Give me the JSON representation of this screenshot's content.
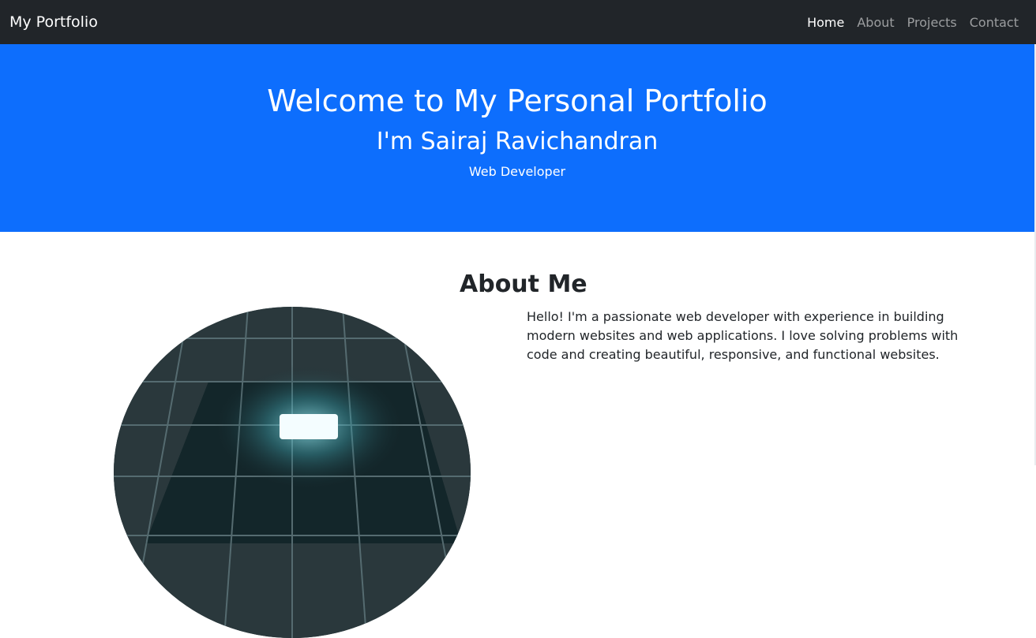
{
  "navbar": {
    "brand": "My Portfolio",
    "links": [
      {
        "label": "Home",
        "active": true
      },
      {
        "label": "About",
        "active": false
      },
      {
        "label": "Projects",
        "active": false
      },
      {
        "label": "Contact",
        "active": false
      }
    ]
  },
  "hero": {
    "title": "Welcome to My Personal Portfolio",
    "name": "I'm Sairaj Ravichandran",
    "role": "Web Developer"
  },
  "about": {
    "heading": "About Me",
    "text": "Hello! I'm a passionate web developer with experience in building modern websites and web applications. I love solving problems with code and creating beautiful, responsive, and functional websites."
  },
  "colors": {
    "navbar_bg": "#212529",
    "hero_bg": "#0d6efd",
    "text": "#212529"
  }
}
